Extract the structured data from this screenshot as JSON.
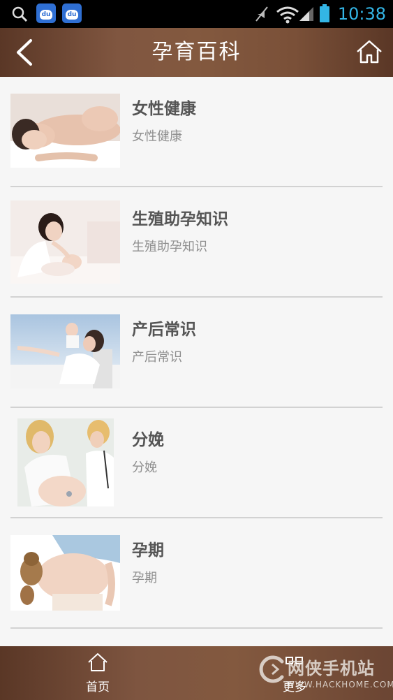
{
  "status_bar": {
    "time": "10:38",
    "icons": [
      "search-icon",
      "baidu-icon",
      "baidu-icon",
      "mute-icon",
      "wifi-icon",
      "signal-icon",
      "battery-icon"
    ],
    "baidu_text": "du"
  },
  "header": {
    "title": "孕育百科",
    "back_icon": "chevron-left-icon",
    "home_icon": "home-icon"
  },
  "list": {
    "items": [
      {
        "title": "女性健康",
        "subtitle": "女性健康"
      },
      {
        "title": "生殖助孕知识",
        "subtitle": "生殖助孕知识"
      },
      {
        "title": "产后常识",
        "subtitle": "产后常识"
      },
      {
        "title": "分娩",
        "subtitle": "分娩"
      },
      {
        "title": "孕期",
        "subtitle": "孕期"
      }
    ]
  },
  "bottom_nav": {
    "tabs": [
      {
        "label": "首页",
        "icon": "home-icon"
      },
      {
        "label": "更多",
        "icon": "grid-icon"
      }
    ]
  },
  "watermark": {
    "main": "网侠手机站",
    "sub": "WWW.HACKHOME.COM"
  },
  "colors": {
    "accent": "#33b5e5",
    "bar_brown": "#7e5540",
    "background": "#f6f6f6",
    "title_text": "#555555",
    "subtitle_text": "#8f8f8f"
  }
}
